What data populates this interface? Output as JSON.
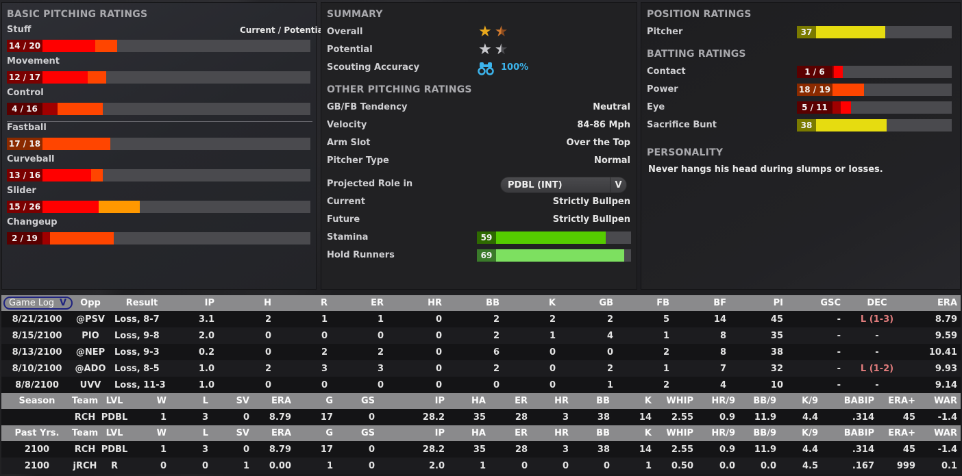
{
  "basic_pitching": {
    "title": "BASIC PITCHING RATINGS",
    "column_hint": "Current / Potential",
    "ratings": [
      {
        "label": "Stuff",
        "text": "14 / 20",
        "current": 14,
        "potential": 20
      },
      {
        "label": "Movement",
        "text": "12 / 17",
        "current": 12,
        "potential": 17
      },
      {
        "label": "Control",
        "text": "4 / 16",
        "current": 4,
        "potential": 16
      }
    ],
    "pitches": [
      {
        "label": "Fastball",
        "text": "17 / 18",
        "current": 17,
        "potential": 18
      },
      {
        "label": "Curveball",
        "text": "13 / 16",
        "current": 13,
        "potential": 16
      },
      {
        "label": "Slider",
        "text": "15 / 26",
        "current": 15,
        "potential": 26
      },
      {
        "label": "Changeup",
        "text": "2 / 19",
        "current": 2,
        "potential": 19
      }
    ]
  },
  "summary": {
    "title": "SUMMARY",
    "overall_label": "Overall",
    "overall_stars": 1.5,
    "potential_label": "Potential",
    "potential_stars": 1.5,
    "scouting_label": "Scouting Accuracy",
    "scouting_value": "100%",
    "scouting_icon": "binoculars-icon",
    "accent_color": "#3cb4ec"
  },
  "other_pitching": {
    "title": "OTHER PITCHING RATINGS",
    "rows": [
      {
        "label": "GB/FB Tendency",
        "value": "Neutral"
      },
      {
        "label": "Velocity",
        "value": "84-86 Mph"
      },
      {
        "label": "Arm Slot",
        "value": "Over the Top"
      },
      {
        "label": "Pitcher Type",
        "value": "Normal"
      }
    ],
    "projected_role_label": "Projected Role in",
    "projected_role_select": "PDBL (INT)",
    "current_label": "Current",
    "current_value": "Strictly Bullpen",
    "future_label": "Future",
    "future_value": "Strictly Bullpen",
    "stamina_label": "Stamina",
    "stamina_value": 59,
    "hold_runners_label": "Hold Runners",
    "hold_runners_value": 69
  },
  "position_ratings": {
    "title": "POSITION RATINGS",
    "pitcher_label": "Pitcher",
    "pitcher_value": 37
  },
  "batting_ratings": {
    "title": "BATTING RATINGS",
    "rows": [
      {
        "label": "Contact",
        "text": "1 / 6",
        "current": 1,
        "potential": 6
      },
      {
        "label": "Power",
        "text": "18 / 19",
        "current": 18,
        "potential": 19
      },
      {
        "label": "Eye",
        "text": "5 / 11",
        "current": 5,
        "potential": 11
      }
    ],
    "bunt_label": "Sacrifice Bunt",
    "bunt_value": 38
  },
  "personality": {
    "title": "PERSONALITY",
    "text": "Never hangs his head during slumps or losses."
  },
  "game_log": {
    "selector": "Game Log",
    "columns": [
      "Opp",
      "Result",
      "IP",
      "H",
      "R",
      "ER",
      "HR",
      "BB",
      "K",
      "GB",
      "FB",
      "BF",
      "PI",
      "GSC",
      "DEC",
      "ERA"
    ],
    "rows": [
      [
        "8/21/2100",
        "@PSV",
        "Loss, 8-7",
        "3.1",
        "2",
        "1",
        "1",
        "0",
        "2",
        "2",
        "2",
        "5",
        "14",
        "45",
        "-",
        "L (1-3)",
        "8.79"
      ],
      [
        "8/15/2100",
        "PIO",
        "Loss, 9-8",
        "2.0",
        "0",
        "0",
        "0",
        "0",
        "2",
        "1",
        "4",
        "1",
        "8",
        "35",
        "-",
        "-",
        "9.59"
      ],
      [
        "8/13/2100",
        "@NEP",
        "Loss, 9-3",
        "0.2",
        "0",
        "2",
        "2",
        "0",
        "6",
        "0",
        "0",
        "2",
        "8",
        "38",
        "-",
        "-",
        "10.41"
      ],
      [
        "8/10/2100",
        "@ADO",
        "Loss, 8-5",
        "1.0",
        "2",
        "3",
        "3",
        "0",
        "2",
        "0",
        "2",
        "1",
        "7",
        "32",
        "-",
        "L (1-2)",
        "9.93"
      ],
      [
        "8/8/2100",
        "UVV",
        "Loss, 11-3",
        "1.0",
        "0",
        "0",
        "0",
        "0",
        "0",
        "0",
        "1",
        "2",
        "4",
        "10",
        "-",
        "-",
        "9.14"
      ]
    ]
  },
  "season_stats": {
    "columns": [
      "Season",
      "Team",
      "LVL",
      "W",
      "L",
      "SV",
      "ERA",
      "G",
      "GS",
      "IP",
      "HA",
      "ER",
      "HR",
      "BB",
      "K",
      "WHIP",
      "HR/9",
      "BB/9",
      "K/9",
      "BABIP",
      "ERA+",
      "WAR"
    ],
    "rows": [
      [
        "",
        "RCH",
        "PDBL",
        "1",
        "3",
        "0",
        "8.79",
        "17",
        "0",
        "28.2",
        "35",
        "28",
        "3",
        "38",
        "14",
        "2.55",
        "0.9",
        "11.9",
        "4.4",
        ".314",
        "45",
        "-1.4"
      ]
    ]
  },
  "past_stats": {
    "columns": [
      "Past Yrs.",
      "Team",
      "LVL",
      "W",
      "L",
      "SV",
      "ERA",
      "G",
      "GS",
      "IP",
      "HA",
      "ER",
      "HR",
      "BB",
      "K",
      "WHIP",
      "HR/9",
      "BB/9",
      "K/9",
      "BABIP",
      "ERA+",
      "WAR"
    ],
    "rows": [
      [
        "2100",
        "RCH",
        "PDBL",
        "1",
        "3",
        "0",
        "8.79",
        "17",
        "0",
        "28.2",
        "35",
        "28",
        "3",
        "38",
        "14",
        "2.55",
        "0.9",
        "11.9",
        "4.4",
        ".314",
        "45",
        "-1.4"
      ],
      [
        "2100",
        "jRCH",
        "R",
        "0",
        "0",
        "1",
        "0.00",
        "1",
        "0",
        "2.0",
        "1",
        "0",
        "0",
        "0",
        "1",
        "0.50",
        "0.0",
        "0.0",
        "4.5",
        ".167",
        "999",
        "0.1"
      ]
    ]
  }
}
